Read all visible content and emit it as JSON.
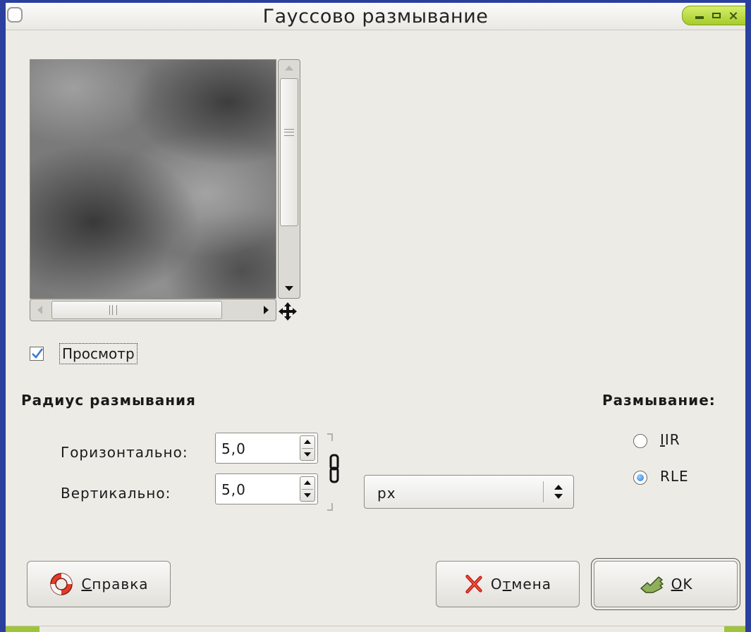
{
  "window": {
    "title": "Гауссово размывание",
    "accent_color": "#2a3f9e",
    "wm_buttons_color": "#a6cc2a"
  },
  "preview": {
    "checkbox_label": "Просмотр",
    "checked": true
  },
  "blur_radius": {
    "section_label": "Радиус размывания",
    "horizontal_label": "Горизонтально:",
    "horizontal_value": "5,0",
    "vertical_label": "Вертикально:",
    "vertical_value": "5,0",
    "unit": "px",
    "chain_icon": "chain-link-icon"
  },
  "blur_method": {
    "section_label": "Размывание:",
    "options": [
      {
        "label_first": "I",
        "label_rest": "IR",
        "selected": false
      },
      {
        "label_first": "",
        "label_rest": "RLE",
        "selected": true
      }
    ]
  },
  "buttons": {
    "help_first": "С",
    "help_rest": "правка",
    "cancel_pre": "О",
    "cancel_mnemonic": "т",
    "cancel_rest": "мена",
    "ok_first": "O",
    "ok_rest": "K"
  },
  "icons": {
    "help": "lifebuoy-icon",
    "cancel": "red-x-icon",
    "ok": "hand-pointing-icon",
    "navigate": "move-arrows-icon"
  }
}
